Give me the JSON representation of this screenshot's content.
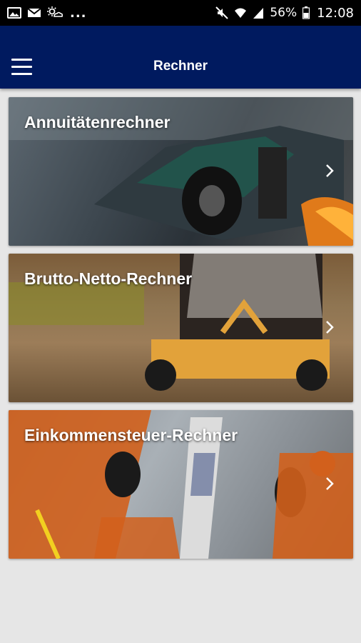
{
  "status_bar": {
    "battery_percent": "56%",
    "time": "12:08",
    "notification_overflow": "...",
    "icons_left": [
      "image-icon",
      "mail-icon",
      "weather-icon"
    ],
    "icons_right": [
      "mute-icon",
      "wifi-icon",
      "signal-icon",
      "battery-icon"
    ]
  },
  "app_bar": {
    "title": "Rechner",
    "menu_icon": "hamburger-menu-icon",
    "background_color": "#001a5f"
  },
  "cards": [
    {
      "title": "Annuitätenrechner",
      "image": "formula-one-race-car",
      "action_icon": "chevron-right-icon"
    },
    {
      "title": "Brutto-Netto-Rechner",
      "image": "go-kart-driver",
      "action_icon": "chevron-right-icon"
    },
    {
      "title": "Einkommensteuer-Rechner",
      "image": "pit-stop-crew",
      "action_icon": "chevron-right-icon"
    }
  ]
}
